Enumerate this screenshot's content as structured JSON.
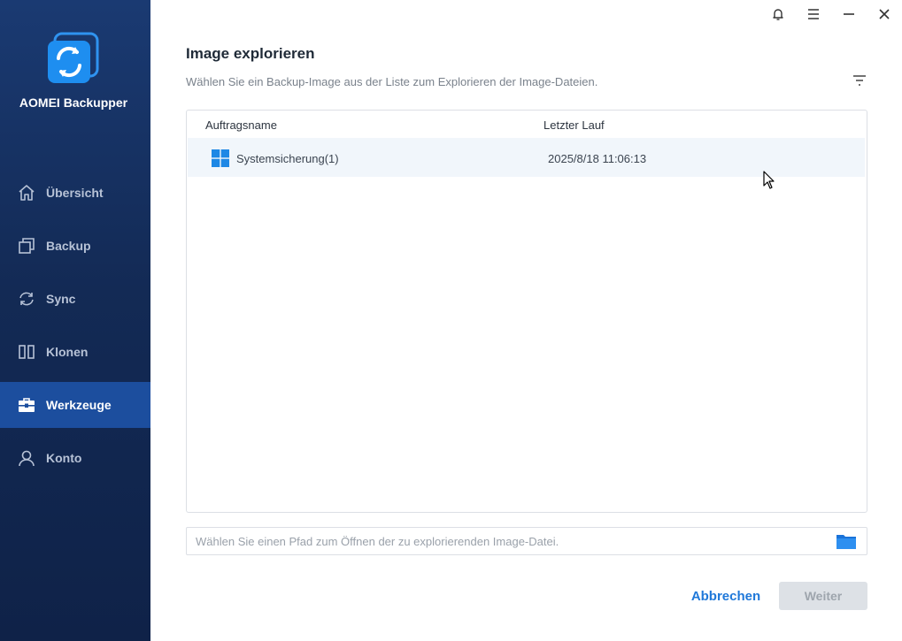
{
  "app": {
    "name": "AOMEI Backupper"
  },
  "sidebar": {
    "items": [
      {
        "label": "Übersicht",
        "icon": "home-icon",
        "active": false
      },
      {
        "label": "Backup",
        "icon": "backup-icon",
        "active": false
      },
      {
        "label": "Sync",
        "icon": "sync-icon",
        "active": false
      },
      {
        "label": "Klonen",
        "icon": "clone-icon",
        "active": false
      },
      {
        "label": "Werkzeuge",
        "icon": "toolbox-icon",
        "active": true
      },
      {
        "label": "Konto",
        "icon": "user-icon",
        "active": false
      }
    ]
  },
  "window_controls": [
    "bell-icon",
    "menu-icon",
    "minimize-icon",
    "close-icon"
  ],
  "main": {
    "title": "Image explorieren",
    "subtitle": "Wählen Sie ein Backup-Image aus der Liste zum Explorieren der Image-Dateien.",
    "table": {
      "columns": [
        "Auftragsname",
        "Letzter Lauf"
      ],
      "rows": [
        {
          "name": "Systemsicherung(1)",
          "last_run": "2025/8/18 11:06:13",
          "icon": "windows-icon"
        }
      ]
    },
    "path_input": {
      "placeholder": "Wählen Sie einen Pfad zum Öffnen der zu explorierenden Image-Datei.",
      "value": ""
    },
    "buttons": {
      "cancel": "Abbrechen",
      "next": "Weiter"
    }
  },
  "colors": {
    "sidebar_bg": "#132a55",
    "sidebar_active": "#1c4e9e",
    "accent": "#1f78d9",
    "row_highlight": "#f1f6fb",
    "disabled_button": "#dde1e6"
  }
}
